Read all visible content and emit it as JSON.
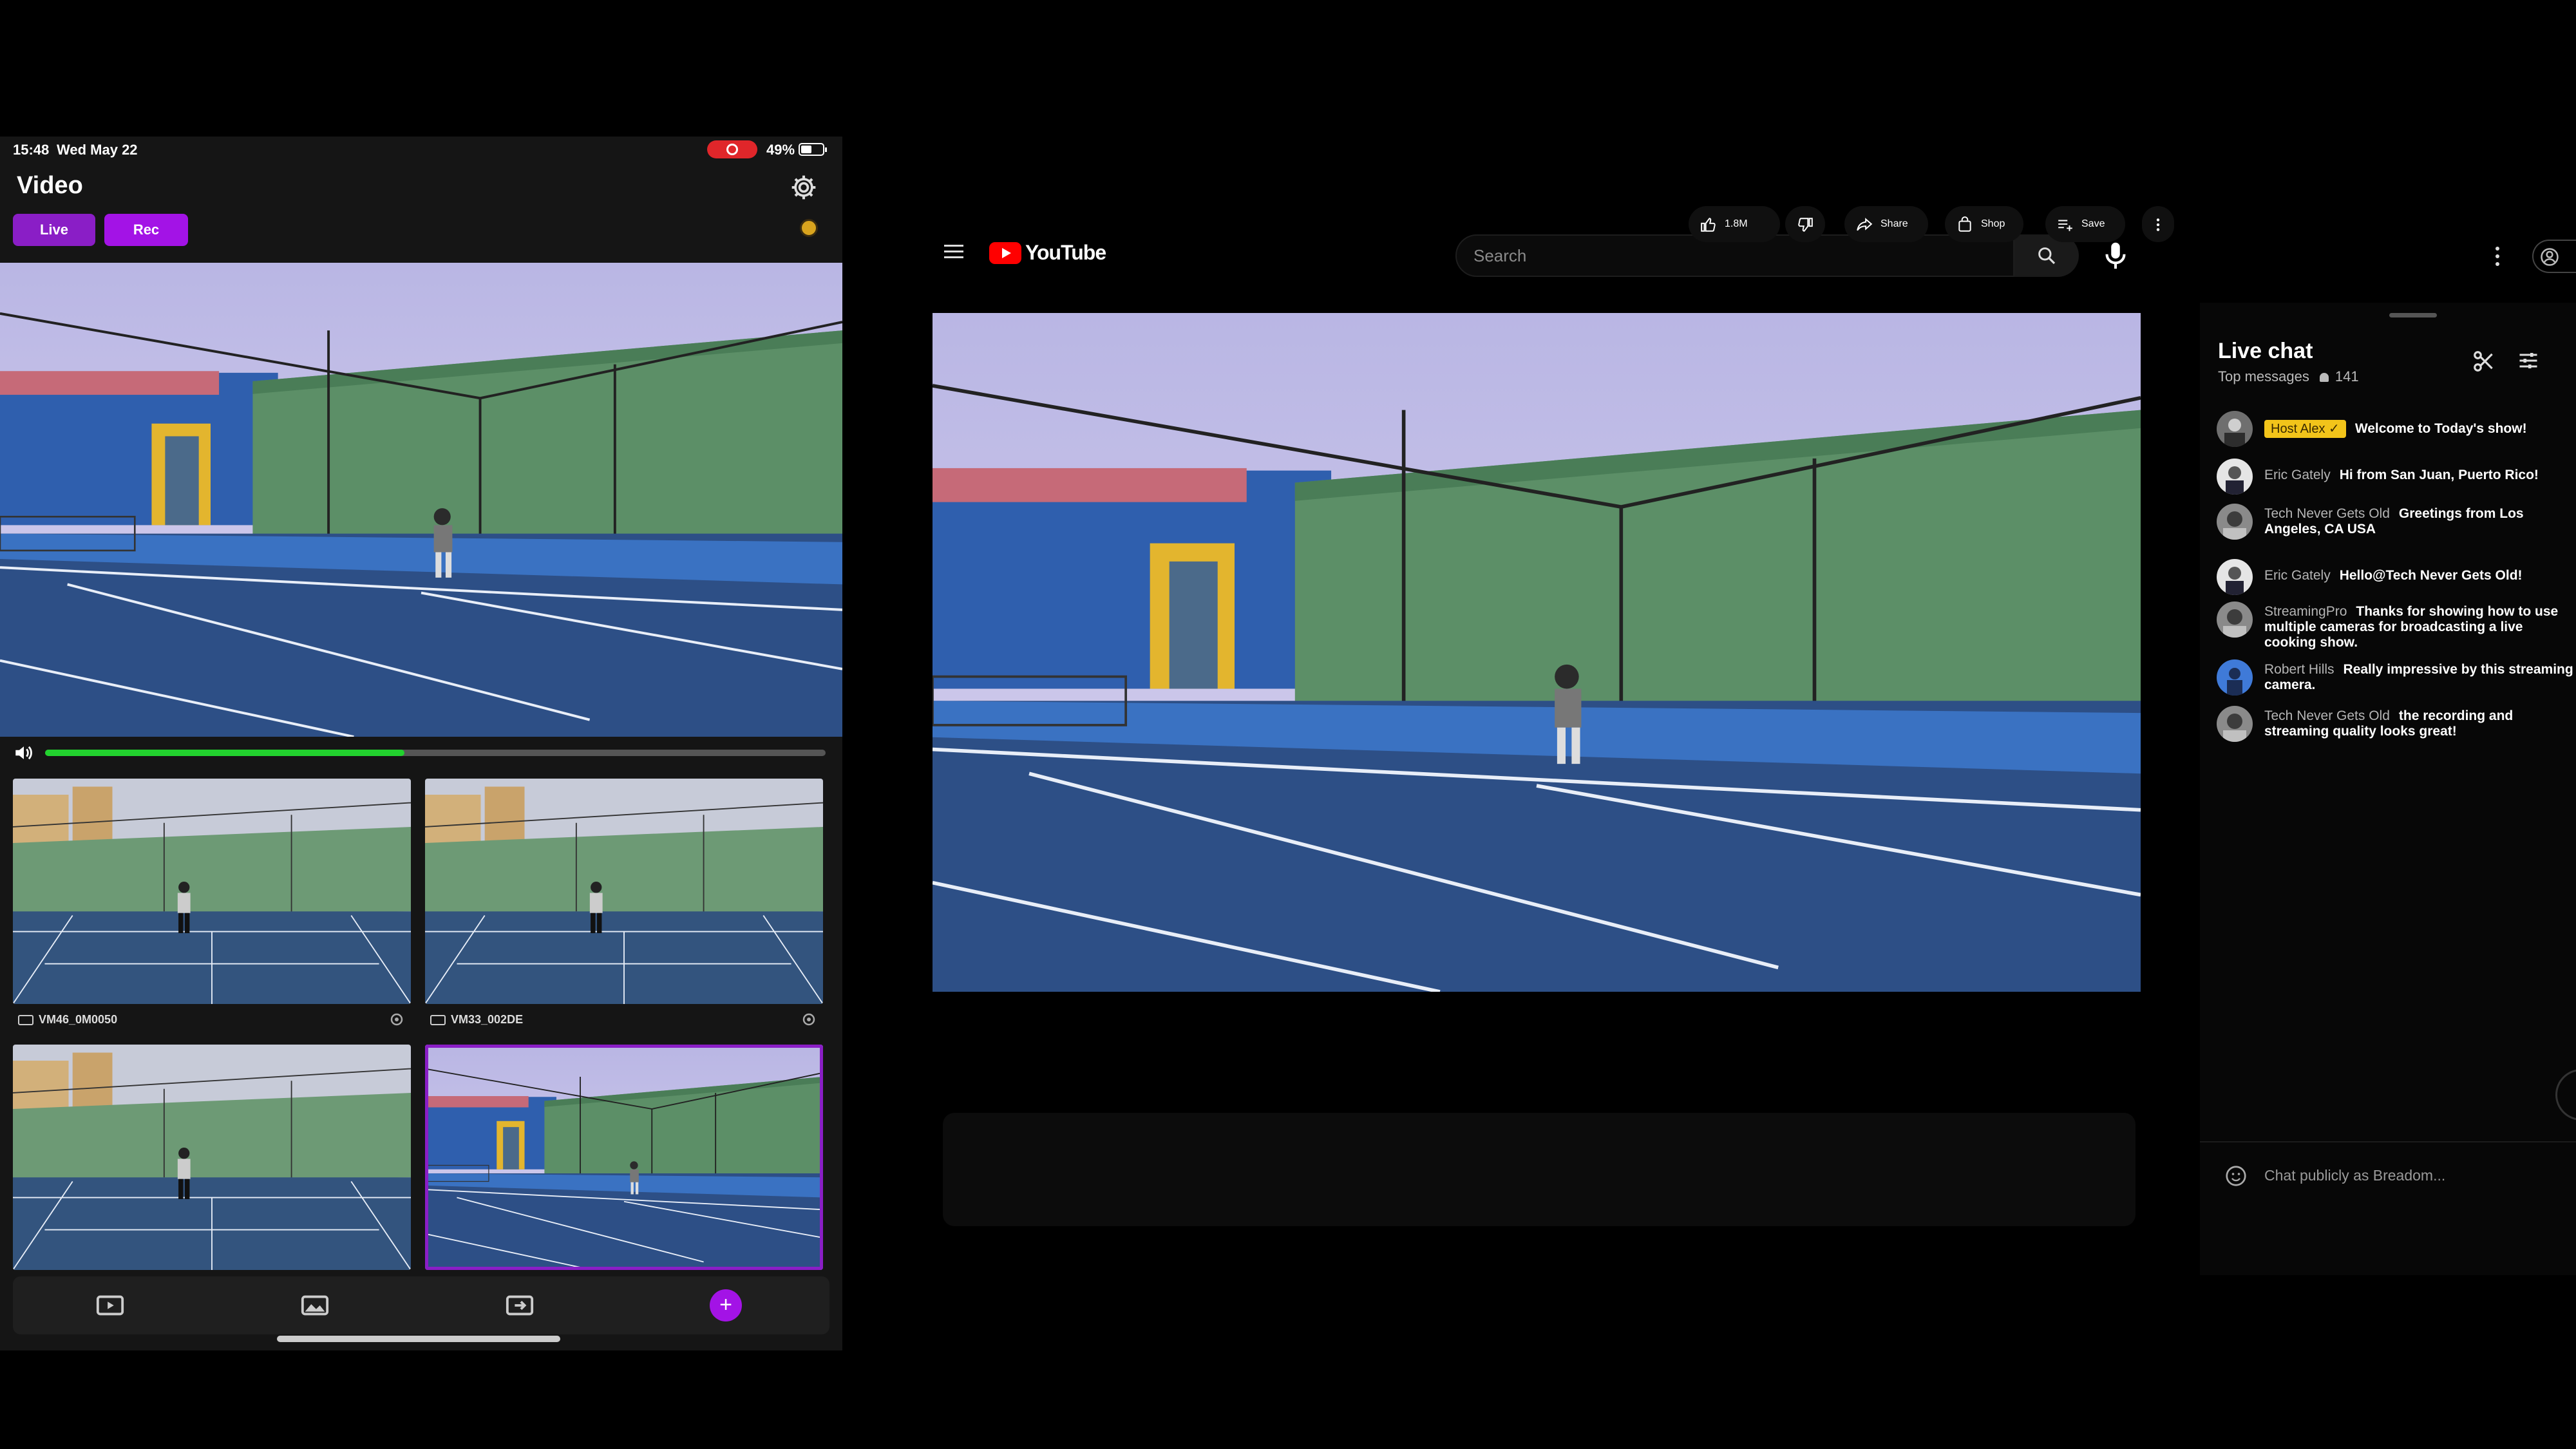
{
  "ipad": {
    "status": {
      "time": "15:48",
      "date": "Wed May 22",
      "battery": "49%"
    },
    "title": "Video",
    "live_label": "Live",
    "rec_label": "Rec",
    "volume_level": 0.46,
    "cameras": [
      {
        "label": "VM46_0M0050"
      },
      {
        "label": "VM33_002DE"
      }
    ],
    "icons": [
      "gear-icon",
      "speaker-icon",
      "video-icon",
      "gallery-icon",
      "switch-icon",
      "add-icon"
    ],
    "add_label": "+",
    "colors": {
      "accent": "#9b1fd6",
      "record": "#e0262a",
      "volume": "#22d12e"
    }
  },
  "youtube": {
    "logo_text": "YouTube",
    "search_placeholder": "Search",
    "actions": {
      "likes": "1.8M",
      "share": "Share",
      "shop": "Shop",
      "save": "Save"
    },
    "chat": {
      "title": "Live chat",
      "mode": "Top messages",
      "viewers": "141",
      "messages": [
        {
          "author": "Host Alex",
          "text": "Welcome to Today's show!"
        },
        {
          "author": "Eric Gately",
          "text": "Hi from San Juan, Puerto Rico!"
        },
        {
          "author": "Tech Never Gets Old",
          "text": "Greetings from Los Angeles, CA USA"
        },
        {
          "author": "Eric Gately",
          "text": "Hello@Tech Never Gets Old!"
        },
        {
          "author": "StreamingPro",
          "text": "Thanks for showing how to use multiple cameras for broadcasting a live cooking show."
        },
        {
          "author": "Robert Hills",
          "text": "Really impressive by this streaming camera."
        },
        {
          "author": "Tech Never Gets Old",
          "text": "the recording and streaming quality looks great!"
        }
      ],
      "input_placeholder": "Chat publicly as Breadom..."
    },
    "colors": {
      "brand": "#ff0000",
      "host_badge": "#f2c41a"
    }
  }
}
